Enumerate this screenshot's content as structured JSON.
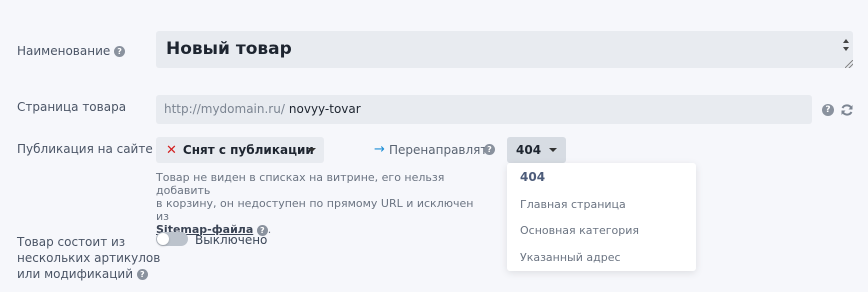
{
  "fields": {
    "name": {
      "label": "Наименование",
      "value": "Новый товар"
    },
    "product_page": {
      "label": "Страница товара",
      "url_prefix": "http://mydomain.ru/",
      "slug": "novyy-tovar",
      "icons": [
        "help-icon",
        "refresh-icon"
      ]
    },
    "publication": {
      "label": "Публикация на сайте",
      "selected": "Снят с публикации",
      "status_icon": "x-icon",
      "status_color": "#d32020",
      "description_parts": [
        "Товар не виден в списках на витрине, его нельзя добавить",
        "в корзину, он недоступен по прямому URL и исключен из"
      ],
      "sitemap_link": "Sitemap-файла",
      "end_dot": "."
    },
    "redirect": {
      "label": "Перенаправлять",
      "arrow": "→",
      "arrow_color": "#1f8fd6",
      "selected": "404",
      "options": [
        "404",
        "Главная страница",
        "Основная категория",
        "Указанный адрес"
      ]
    },
    "variants": {
      "label_lines": [
        "Товар состоит из",
        "нескольких артикулов",
        "или модификаций"
      ],
      "toggle_label": "Выключено",
      "toggle_on": false
    }
  },
  "help_glyph": "?"
}
